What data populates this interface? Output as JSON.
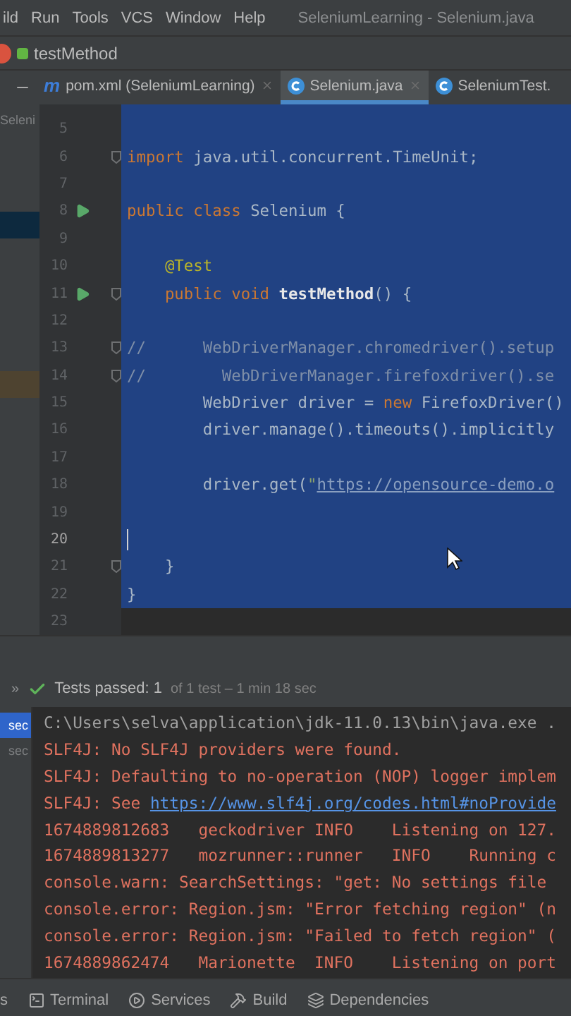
{
  "menu": {
    "items": [
      "ild",
      "Run",
      "Tools",
      "VCS",
      "Window",
      "Help"
    ],
    "title": "SeleniumLearning - Selenium.java"
  },
  "navigation": {
    "crumb": "testMethod"
  },
  "tabs": [
    {
      "badge": "m",
      "label": "pom.xml (SeleniumLearning)",
      "selected": false,
      "closable": true
    },
    {
      "label": "Selenium.java",
      "selected": true,
      "closable": true
    },
    {
      "label": "SeleniumTest.",
      "selected": false,
      "closable": false
    }
  ],
  "project_panel": {
    "rows": [
      {
        "label": "Seleni",
        "selected": false
      },
      {
        "selected": true
      },
      {
        "selected": false,
        "color": "#4e4330"
      }
    ]
  },
  "editor": {
    "lines": [
      {
        "number": "5",
        "selected": true
      },
      {
        "number": "6",
        "selected": true,
        "fold": true,
        "tokens": [
          {
            "kind": "keyword",
            "text": "import "
          },
          {
            "kind": "plain",
            "text": "java.util.concurrent.TimeUnit;"
          }
        ]
      },
      {
        "number": "7",
        "selected": true
      },
      {
        "number": "8",
        "selected": true,
        "run": true,
        "tokens": [
          {
            "kind": "keyword",
            "text": "public class "
          },
          {
            "kind": "plain",
            "text": "Selenium {"
          }
        ]
      },
      {
        "number": "9",
        "selected": true
      },
      {
        "number": "10",
        "selected": true,
        "tokens": [
          {
            "kind": "annotation",
            "text": "    @Test"
          }
        ]
      },
      {
        "number": "11",
        "selected": true,
        "run": true,
        "fold": true,
        "tokens": [
          {
            "kind": "keyword",
            "text": "    public void "
          },
          {
            "kind": "method",
            "text": "testMethod"
          },
          {
            "kind": "plain",
            "text": "() {"
          }
        ]
      },
      {
        "number": "12",
        "selected": true
      },
      {
        "number": "13",
        "selected": true,
        "fold": true,
        "tokens": [
          {
            "kind": "comment",
            "text": "//      WebDriverManager.chromedriver().setup"
          }
        ]
      },
      {
        "number": "14",
        "selected": true,
        "fold": true,
        "tokens": [
          {
            "kind": "comment",
            "text": "//        WebDriverManager.firefoxdriver().se"
          }
        ]
      },
      {
        "number": "15",
        "selected": true,
        "tokens": [
          {
            "kind": "plain",
            "text": "        WebDriver driver = "
          },
          {
            "kind": "keyword",
            "text": "new "
          },
          {
            "kind": "plain",
            "text": "FirefoxDriver()"
          }
        ]
      },
      {
        "number": "16",
        "selected": true,
        "tokens": [
          {
            "kind": "plain",
            "text": "        driver.manage().timeouts().implicitly"
          }
        ]
      },
      {
        "number": "17",
        "selected": true
      },
      {
        "number": "18",
        "selected": true,
        "tokens": [
          {
            "kind": "plain",
            "text": "        driver.get("
          },
          {
            "kind": "string",
            "text": "\""
          },
          {
            "kind": "link",
            "text": "https://opensource-demo.o"
          }
        ]
      },
      {
        "number": "19",
        "selected": true
      },
      {
        "number": "20",
        "selected": true,
        "caret": true
      },
      {
        "number": "21",
        "selected": true,
        "fold": true,
        "tokens": [
          {
            "kind": "plain",
            "text": "    }"
          }
        ]
      },
      {
        "number": "22",
        "selected": true,
        "tokens": [
          {
            "kind": "plain",
            "text": "}"
          }
        ]
      },
      {
        "number": "23"
      }
    ]
  },
  "run_panel": {
    "expand": "»",
    "status": "Tests passed: 1",
    "detail": "of 1 test – 1 min 18 sec",
    "durations": [
      {
        "text": "sec",
        "selected": true
      },
      {
        "text": "sec",
        "selected": false
      }
    ],
    "console": [
      [
        {
          "kind": "normal",
          "text": "C:\\Users\\selva\\application\\jdk-11.0.13\\bin\\java.exe ."
        }
      ],
      [
        {
          "kind": "error",
          "text": "SLF4J: No SLF4J providers were found."
        }
      ],
      [
        {
          "kind": "error",
          "text": "SLF4J: Defaulting to no-operation (NOP) logger implem"
        }
      ],
      [
        {
          "kind": "error",
          "text": "SLF4J: See "
        },
        {
          "kind": "link",
          "text": "https://www.slf4j.org/codes.html#noProvide"
        }
      ],
      [
        {
          "kind": "error",
          "text": "1674889812683   geckodriver INFO    Listening on 127."
        }
      ],
      [
        {
          "kind": "error",
          "text": "1674889813277   mozrunner::runner   INFO    Running c"
        }
      ],
      [
        {
          "kind": "error",
          "text": "console.warn: SearchSettings: \"get: No settings file"
        }
      ],
      [
        {
          "kind": "error",
          "text": "console.error: Region.jsm: \"Error fetching region\" (n"
        }
      ],
      [
        {
          "kind": "error",
          "text": "console.error: Region.jsm: \"Failed to fetch region\" ("
        }
      ],
      [
        {
          "kind": "error",
          "text": "1674889862474   Marionette  INFO    Listening on port"
        }
      ]
    ]
  },
  "toolbar": {
    "items": [
      {
        "kind": "none",
        "label": "s"
      },
      {
        "kind": "terminal",
        "label": "Terminal"
      },
      {
        "kind": "services",
        "label": "Services"
      },
      {
        "kind": "build",
        "label": "Build"
      },
      {
        "kind": "dependencies",
        "label": "Dependencies"
      }
    ]
  }
}
